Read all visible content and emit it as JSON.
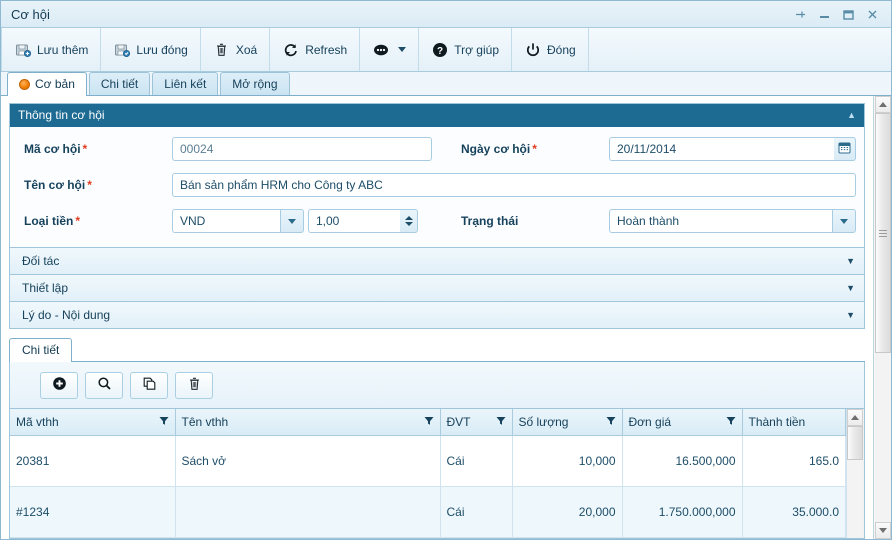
{
  "window": {
    "title": "Cơ hội",
    "controls": [
      {
        "name": "pin-window",
        "glyph": "pin"
      },
      {
        "name": "minimize-window",
        "glyph": "minimize"
      },
      {
        "name": "maximize-window",
        "glyph": "maximize"
      },
      {
        "name": "close-window",
        "glyph": "close"
      }
    ]
  },
  "toolbar": {
    "buttons": [
      {
        "label": "Lưu thêm",
        "icon": "save-add-icon"
      },
      {
        "label": "Lưu đóng",
        "icon": "save-close-icon"
      },
      {
        "label": "Xoá",
        "icon": "trash-icon"
      },
      {
        "label": "Refresh",
        "icon": "refresh-icon"
      },
      {
        "label": "",
        "icon": "more-dots-icon"
      },
      {
        "label": "Trợ giúp",
        "icon": "help-icon"
      },
      {
        "label": "Đóng",
        "icon": "power-icon"
      }
    ]
  },
  "tabs": [
    {
      "label": "Cơ bản",
      "active": true,
      "icon": "orange-radio-icon"
    },
    {
      "label": "Chi tiết",
      "active": false
    },
    {
      "label": "Liên kết",
      "active": false
    },
    {
      "label": "Mở rộng",
      "active": false
    }
  ],
  "panel": {
    "title": "Thông tin cơ hội",
    "collapse_chevron": "▲",
    "fields": {
      "ma_co_hoi": {
        "label": "Mã cơ hội",
        "required": "*",
        "value": "00024"
      },
      "ngay_co_hoi": {
        "label": "Ngày cơ hội",
        "required": "*",
        "value": "20/11/2014",
        "button_icon": "calendar-icon"
      },
      "ten_co_hoi": {
        "label": "Tên cơ hội",
        "required": "*",
        "value": "Bán sản phẩm HRM cho Công ty ABC"
      },
      "loai_tien": {
        "label": "Loại tiền",
        "required": "*",
        "value": "VND",
        "rate": "1,00"
      },
      "trang_thai": {
        "label": "Trạng thái",
        "required": "",
        "value": "Hoàn thành"
      }
    }
  },
  "collapsed_sections": [
    {
      "label": "Đối tác",
      "chevron": "▼"
    },
    {
      "label": "Thiết lập",
      "chevron": "▼"
    },
    {
      "label": "Lý do - Nội dung",
      "chevron": "▼"
    }
  ],
  "detail": {
    "tab_label": "Chi tiết",
    "tools": [
      {
        "name": "add-row-button",
        "icon": "plus-circle-icon"
      },
      {
        "name": "search-button",
        "icon": "magnifier-icon"
      },
      {
        "name": "copy-button",
        "icon": "copy-icon"
      },
      {
        "name": "delete-row-button",
        "icon": "trash-icon"
      }
    ],
    "columns": [
      {
        "label": "Mã vthh",
        "filter": true,
        "align": "left"
      },
      {
        "label": "Tên vthh",
        "filter": true,
        "align": "left"
      },
      {
        "label": "ĐVT",
        "filter": true,
        "align": "left"
      },
      {
        "label": "Số lượng",
        "filter": true,
        "align": "right"
      },
      {
        "label": "Đơn giá",
        "filter": true,
        "align": "right"
      },
      {
        "label": "Thành tiền",
        "filter": false,
        "align": "right"
      }
    ],
    "rows": [
      {
        "ma_vthh": "20381",
        "ten_vthh": "Sách vở",
        "dvt": "Cái",
        "so_luong": "10,000",
        "don_gia": "16.500,000",
        "thanh_tien": "165.0"
      },
      {
        "ma_vthh": "#1234",
        "ten_vthh": "",
        "dvt": "Cái",
        "so_luong": "20,000",
        "don_gia": "1.750.000,000",
        "thanh_tien": "35.000.0"
      }
    ]
  },
  "colors": {
    "panel_header": "#1d6a92",
    "accent_orange": "#f07c00",
    "required_red": "#e03a1e",
    "border_blue": "#9fc6da"
  }
}
